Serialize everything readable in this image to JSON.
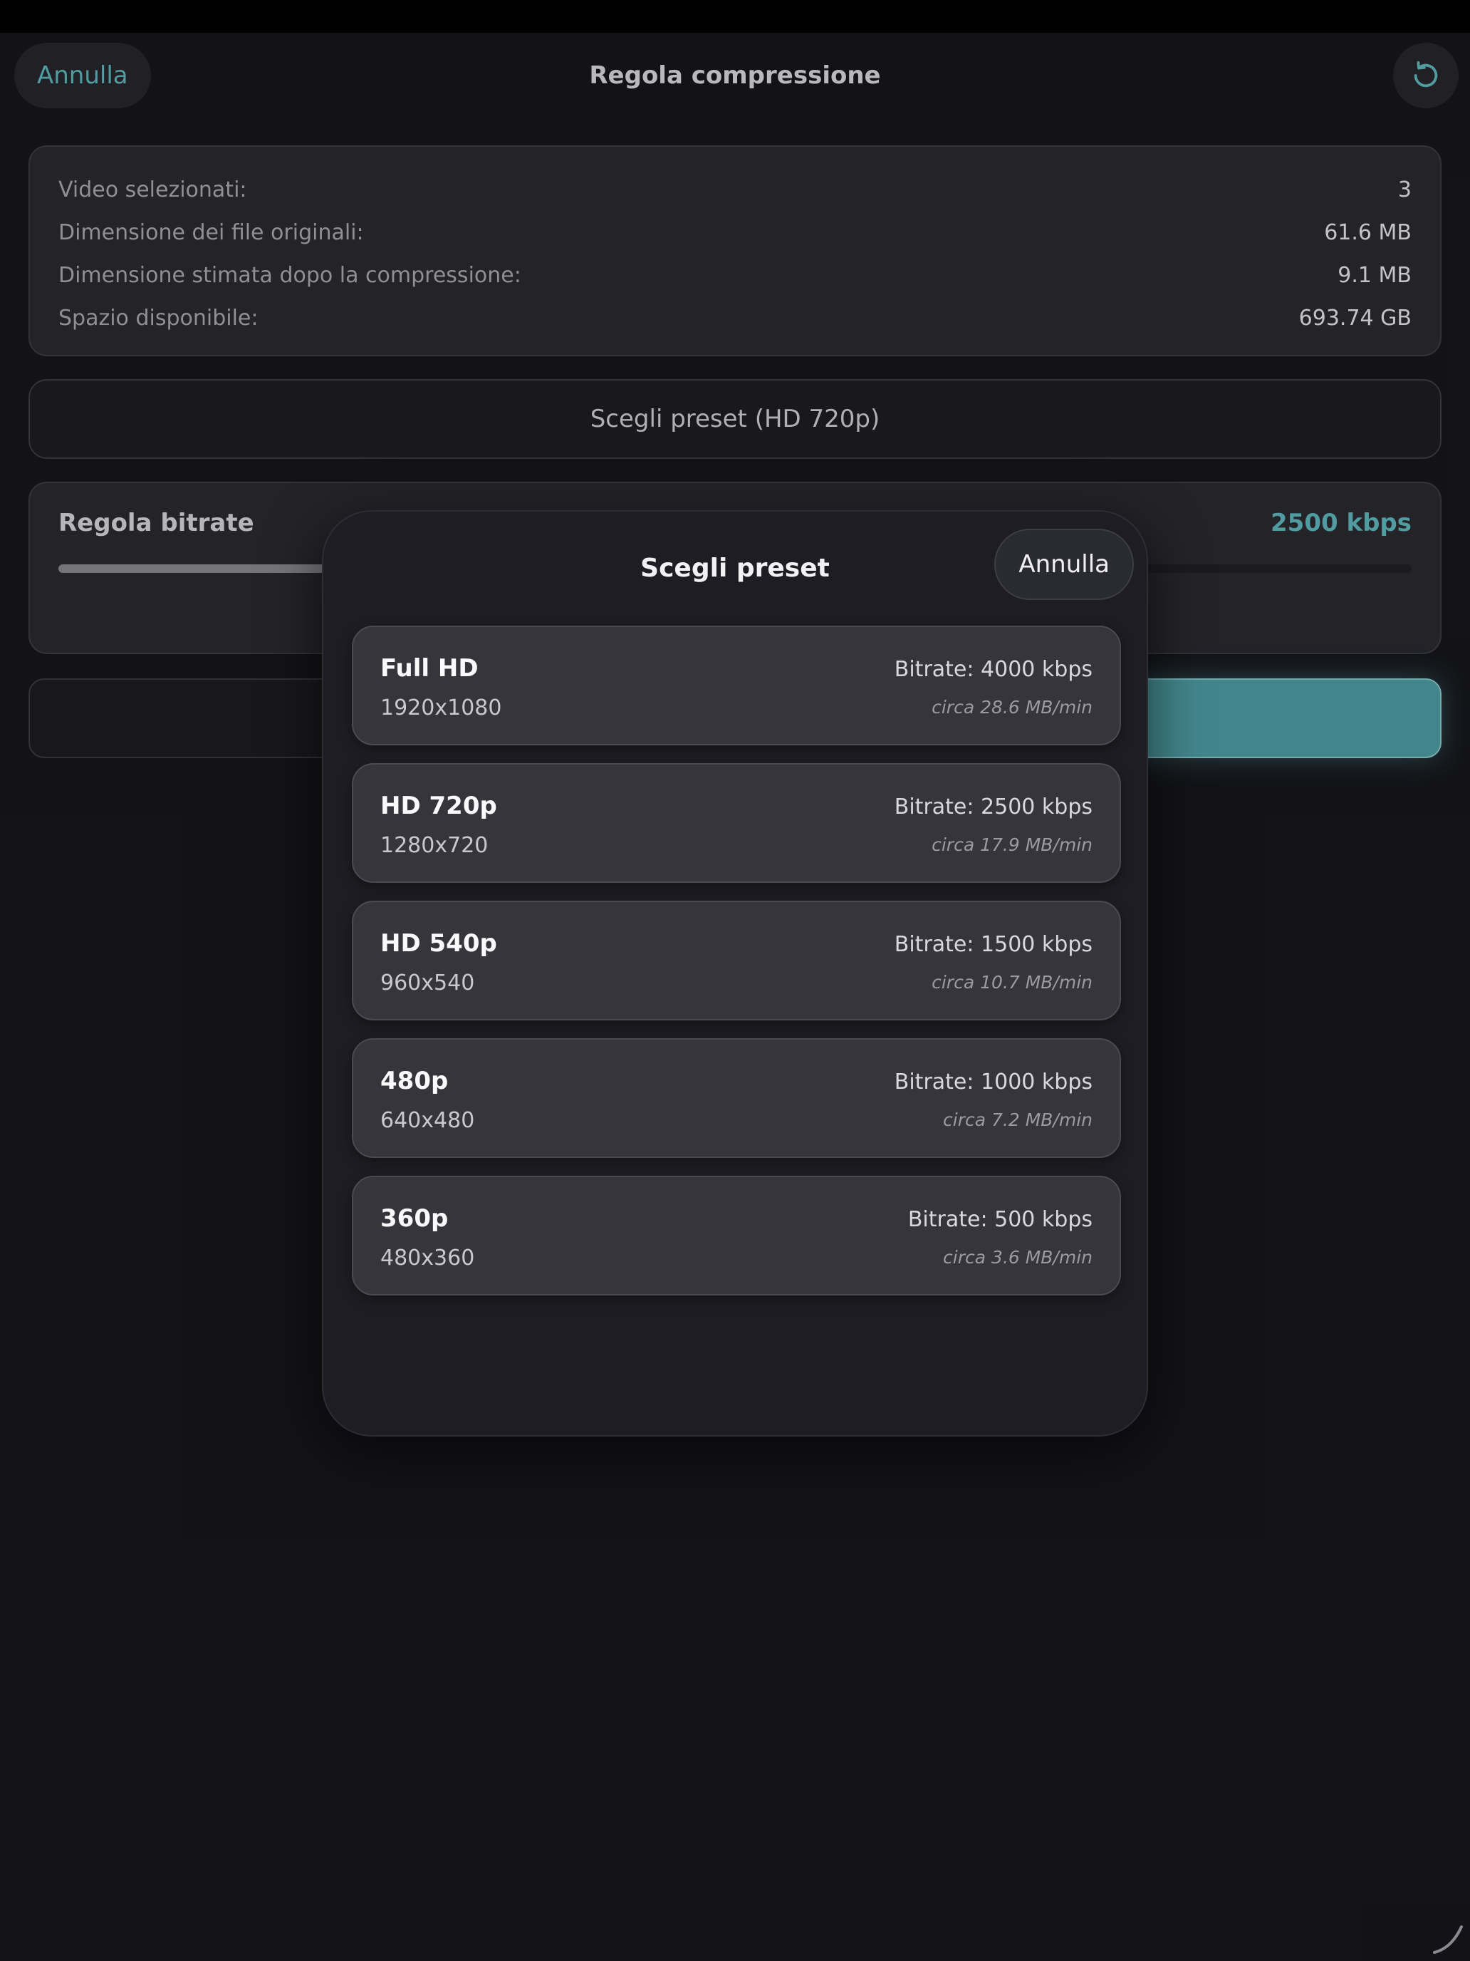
{
  "nav": {
    "cancel_label": "Annulla",
    "title": "Regola compressione",
    "reset_icon": "rotate-ccw-icon"
  },
  "info": [
    {
      "label": "Video selezionati:",
      "value": "3"
    },
    {
      "label": "Dimensione dei file originali:",
      "value": "61.6 MB"
    },
    {
      "label": "Dimensione stimata dopo la compressione:",
      "value": "9.1 MB"
    },
    {
      "label": "Spazio disponibile:",
      "value": "693.74 GB"
    }
  ],
  "preset_button": {
    "label": "Scegli preset (HD 720p)"
  },
  "bitrate": {
    "label": "Regola bitrate",
    "value": "2500 kbps",
    "slider_fraction": 0.45
  },
  "modal": {
    "title": "Scegli preset",
    "cancel_label": "Annulla",
    "presets": [
      {
        "name": "Full HD",
        "resolution": "1920x1080",
        "bitrate": "Bitrate: 4000 kbps",
        "size": "circa 28.6 MB/min"
      },
      {
        "name": "HD 720p",
        "resolution": "1280x720",
        "bitrate": "Bitrate: 2500 kbps",
        "size": "circa 17.9 MB/min"
      },
      {
        "name": "HD 540p",
        "resolution": "960x540",
        "bitrate": "Bitrate: 1500 kbps",
        "size": "circa 10.7 MB/min"
      },
      {
        "name": "480p",
        "resolution": "640x480",
        "bitrate": "Bitrate: 1000 kbps",
        "size": "circa 7.2 MB/min"
      },
      {
        "name": "360p",
        "resolution": "480x360",
        "bitrate": "Bitrate: 500 kbps",
        "size": "circa 3.6 MB/min"
      }
    ]
  },
  "colors": {
    "accent": "#5fb8bd",
    "background": "#17171c",
    "card": "#2a2a30"
  }
}
